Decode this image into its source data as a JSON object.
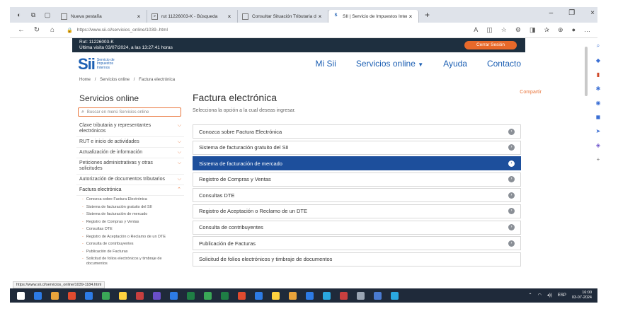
{
  "browser": {
    "tabs": [
      {
        "title": "Nueva pestaña",
        "icon": "tab-page-icon",
        "active": false
      },
      {
        "title": "rut 11226003-K - Búsqueda",
        "icon": "search-icon",
        "active": false
      },
      {
        "title": "Consultar Situación Tributaria de",
        "icon": "tab-page-icon",
        "active": false
      },
      {
        "title": "SII | Servicio de Impuestos Intern",
        "icon": "sii-favicon",
        "active": true
      }
    ],
    "url": "https://www.sii.cl/servicios_online/1039-.html",
    "status_url": "https://www.sii.cl/servicios_online/1039-1184.html"
  },
  "topband": {
    "rut": "Rut: 11226003-K",
    "last_visit": "Última visita 03/07/2024, a las 13:27:41 horas",
    "logout": "Cerrar Sesión"
  },
  "header": {
    "logo_mark": "Sii",
    "logo_text": [
      "Servicio de",
      "Impuestos",
      "Internos"
    ],
    "menu": [
      "Mi Sii",
      "Servicios online",
      "Ayuda",
      "Contacto"
    ]
  },
  "breadcrumb": [
    "Home",
    "/",
    "Servicios online",
    "/",
    "Factura electrónica"
  ],
  "sidebar": {
    "title": "Servicios online",
    "search_placeholder": "Buscar en menú Servicios online",
    "items": [
      "Clave tributaria y representantes electrónicos",
      "RUT e inicio de actividades",
      "Actualización de información",
      "Peticiones administrativas y otras solicitudes",
      "Autorización de documentos tributarios"
    ],
    "open_item": "Factura electrónica",
    "sub_items": [
      "Conozca sobre Factura Electrónica",
      "Sistema de facturación gratuito del SII",
      "Sistema de facturación de mercado",
      "Registro de Compras y Ventas",
      "Consultas DTE",
      "Registro de Aceptación o Reclamo de un DTE",
      "Consulta de contribuyentes",
      "Publicación de Facturas",
      "Solicitud de folios electrónicos y timbraje de documentos"
    ]
  },
  "main": {
    "share": "Compartir",
    "title": "Factura electrónica",
    "subtitle": "Selecciona la opción a la cual deseas ingresar.",
    "options": [
      {
        "label": "Conozca sobre Factura Electrónica",
        "selected": false
      },
      {
        "label": "Sistema de facturación gratuito del SII",
        "selected": false
      },
      {
        "label": "Sistema de facturación de mercado",
        "selected": true
      },
      {
        "label": "Registro de Compras y Ventas",
        "selected": false
      },
      {
        "label": "Consultas DTE",
        "selected": false
      },
      {
        "label": "Registro de Aceptación o Reclamo de un DTE",
        "selected": false
      },
      {
        "label": "Consulta de contribuyentes",
        "selected": false
      },
      {
        "label": "Publicación de Facturas",
        "selected": false
      },
      {
        "label": "Solicitud de folios electrónicos y timbraje de documentos",
        "selected": false
      }
    ]
  },
  "taskbar": {
    "lang": "ESP",
    "time": "16:00",
    "date": "03-07-2024",
    "icon_colors": [
      "#2d7be5",
      "#e8a33b",
      "#e04b2f",
      "#2d7be5",
      "#3aa757",
      "#ffd23f",
      "#c73f3f",
      "#6a4fc9",
      "#2d7be5",
      "#1f7e45",
      "#3aa757",
      "#1f7e45",
      "#e04b2f",
      "#2d7be5",
      "#ffd23f",
      "#e8a33b",
      "#2d7be5",
      "#2aa8e0",
      "#c73f3f",
      "#9aa5b4",
      "#4a7bd1",
      "#2aa8e0"
    ]
  },
  "colors": {
    "accent": "#e9763c",
    "brand": "#1c5fb3",
    "selected": "#1d4f9c",
    "topband": "#1e2f3f"
  }
}
